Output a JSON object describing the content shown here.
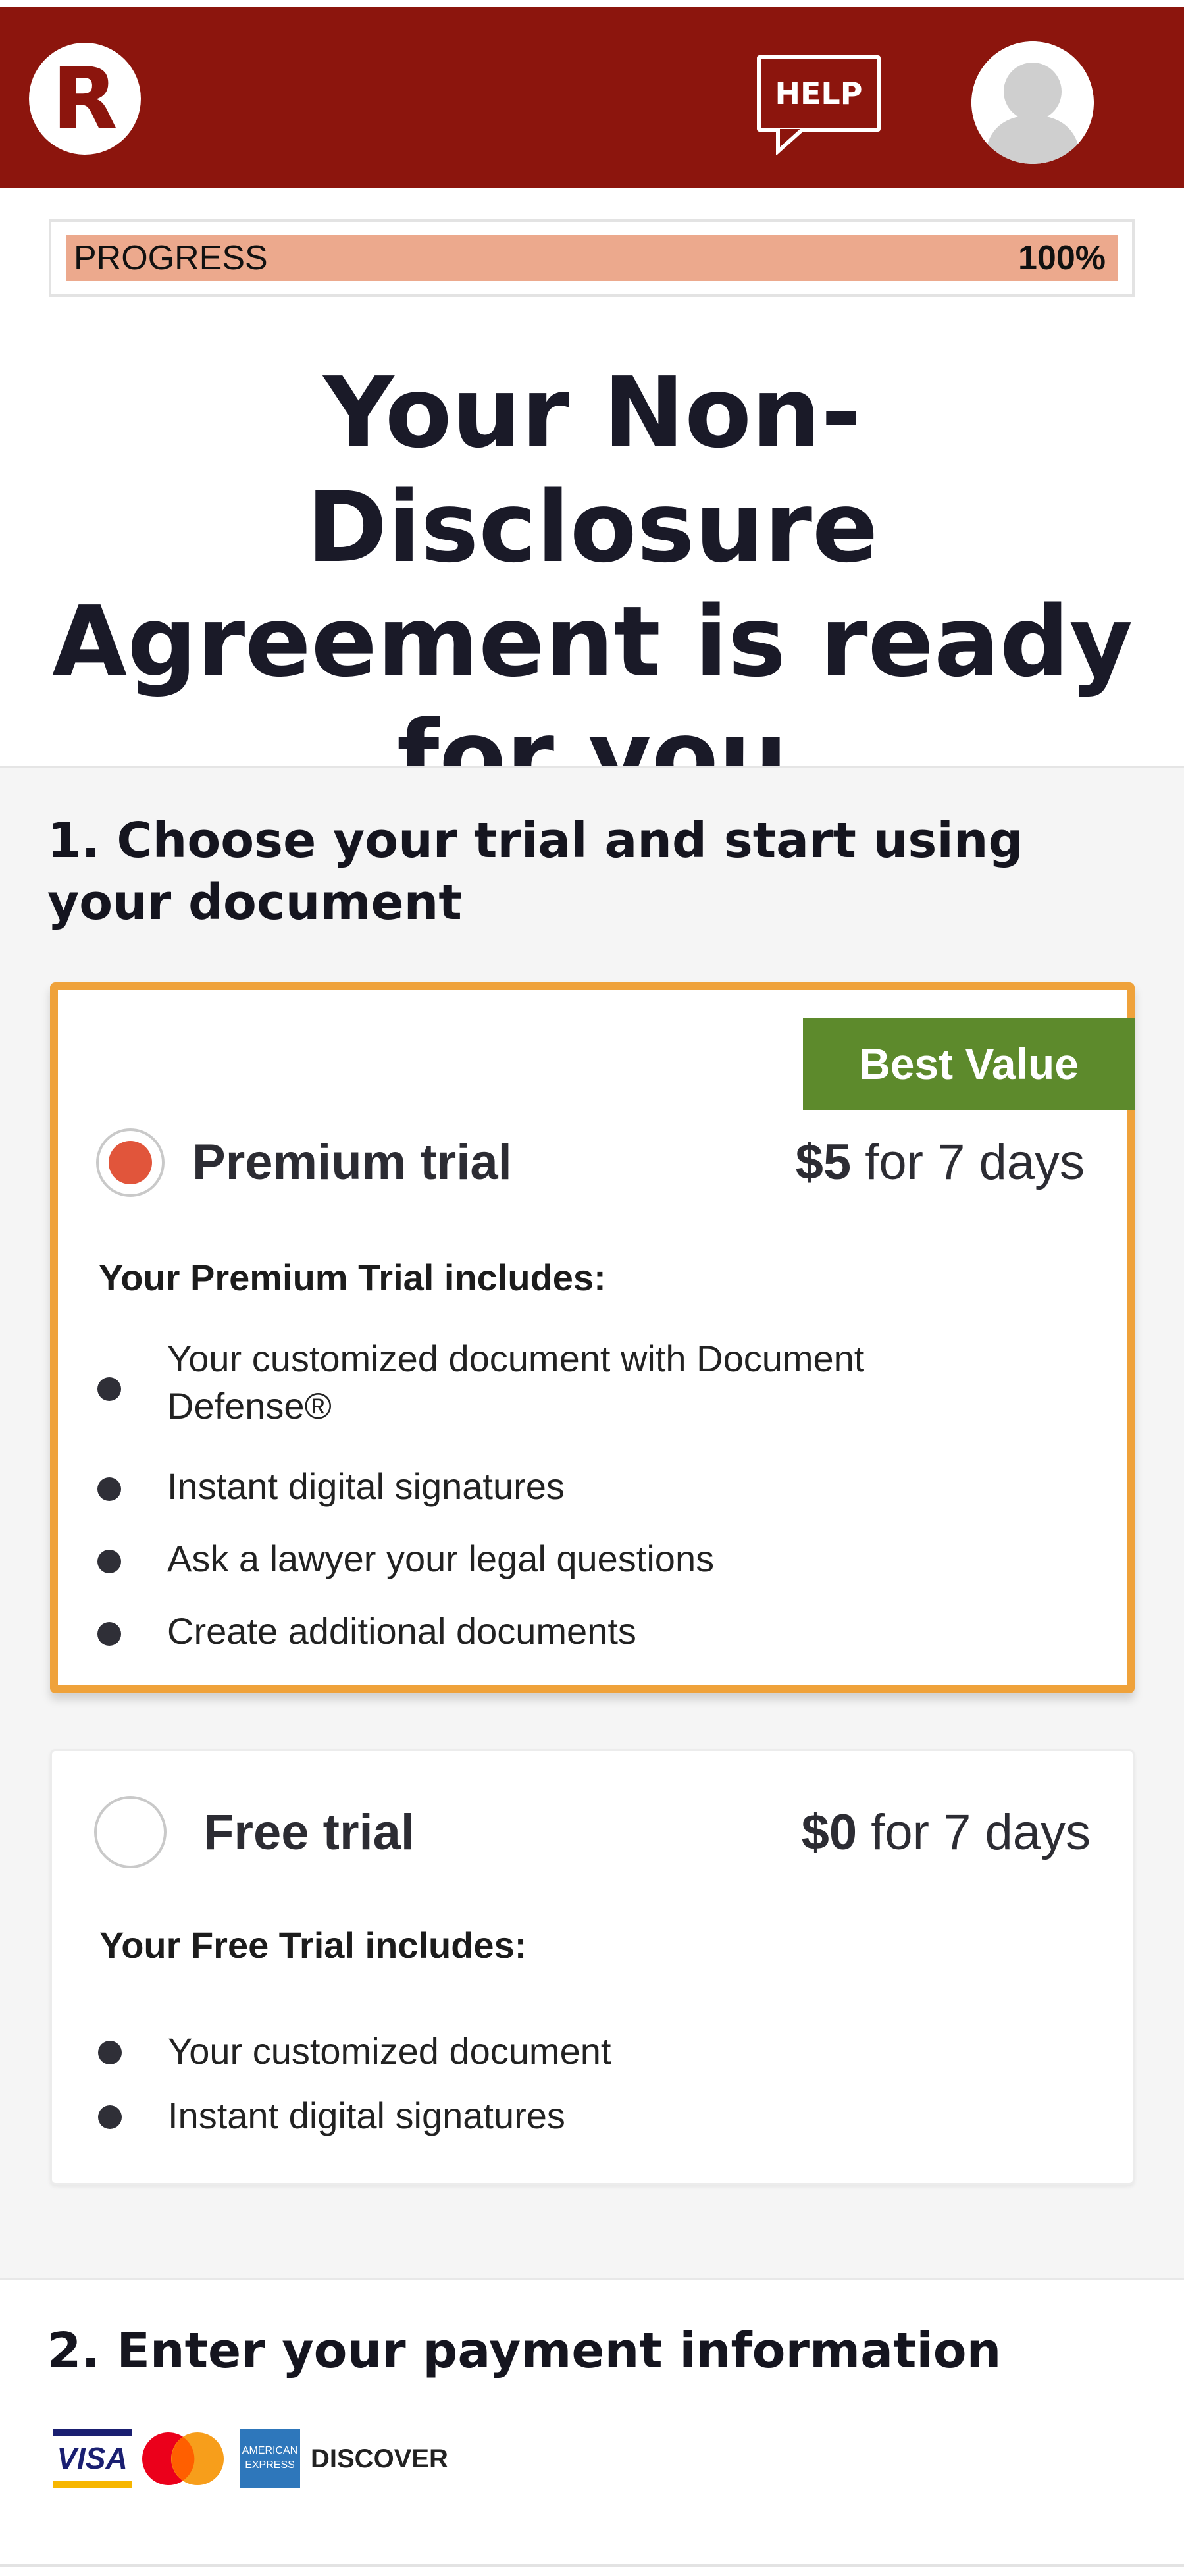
{
  "header": {
    "logo_letter": "R",
    "help_label": "HELP",
    "brand_color": "#8c150d"
  },
  "progress": {
    "label": "PROGRESS",
    "value_text": "100%",
    "value": 100
  },
  "page_title": "Your Non-Disclosure Agreement is ready for you",
  "section1": {
    "title": "1. Choose your trial and start using your document",
    "plans": [
      {
        "name": "Premium trial",
        "price": "$5",
        "period": "for 7 days",
        "selected": true,
        "badge": "Best Value",
        "includes_label": "Your Premium Trial includes:",
        "features": [
          "Your customized document with Document Defense®",
          "Instant digital signatures",
          "Ask a lawyer your legal questions",
          "Create additional documents"
        ]
      },
      {
        "name": "Free trial",
        "price": "$0",
        "period": "for 7 days",
        "selected": false,
        "includes_label": "Your Free Trial includes:",
        "features": [
          "Your customized document",
          "Instant digital signatures"
        ]
      }
    ]
  },
  "section2": {
    "title": "2. Enter your payment information",
    "card_logos": {
      "visa": "VISA",
      "amex": "AMERICAN EXPRESS",
      "discover": "DISCOVER"
    }
  },
  "colors": {
    "accent_orange": "#efa23b",
    "best_value_green": "#5d8a2c",
    "radio_selected": "#e1553b",
    "progress_fill": "#eca98d"
  }
}
